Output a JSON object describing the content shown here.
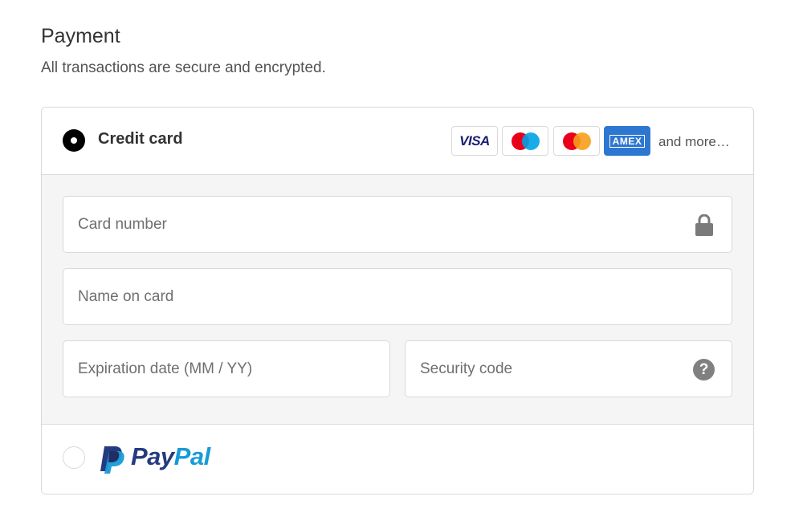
{
  "header": {
    "title": "Payment",
    "subtitle": "All transactions are secure and encrypted."
  },
  "credit_card": {
    "label": "Credit card",
    "selected": true,
    "brands": [
      {
        "name": "visa",
        "text": "VISA"
      },
      {
        "name": "maestro"
      },
      {
        "name": "mastercard"
      },
      {
        "name": "amex",
        "text": "AMEX"
      }
    ],
    "and_more": "and more…"
  },
  "form": {
    "card_number": {
      "placeholder": "Card number",
      "value": ""
    },
    "name_on_card": {
      "placeholder": "Name on card",
      "value": ""
    },
    "expiration": {
      "placeholder": "Expiration date (MM / YY)",
      "value": ""
    },
    "security_code": {
      "placeholder": "Security code",
      "value": "",
      "help_text": "?"
    }
  },
  "paypal": {
    "selected": false,
    "logo_text_pay": "Pay",
    "logo_text_pal": "Pal"
  },
  "colors": {
    "visa_blue": "#1a1f71",
    "maestro_red": "#eb001b",
    "maestro_blue": "#00a2e5",
    "mastercard_red": "#eb001b",
    "mastercard_orange": "#f79e1b",
    "amex_blue": "#2e77d0",
    "paypal_dark": "#253b80",
    "paypal_light": "#179bd7"
  }
}
